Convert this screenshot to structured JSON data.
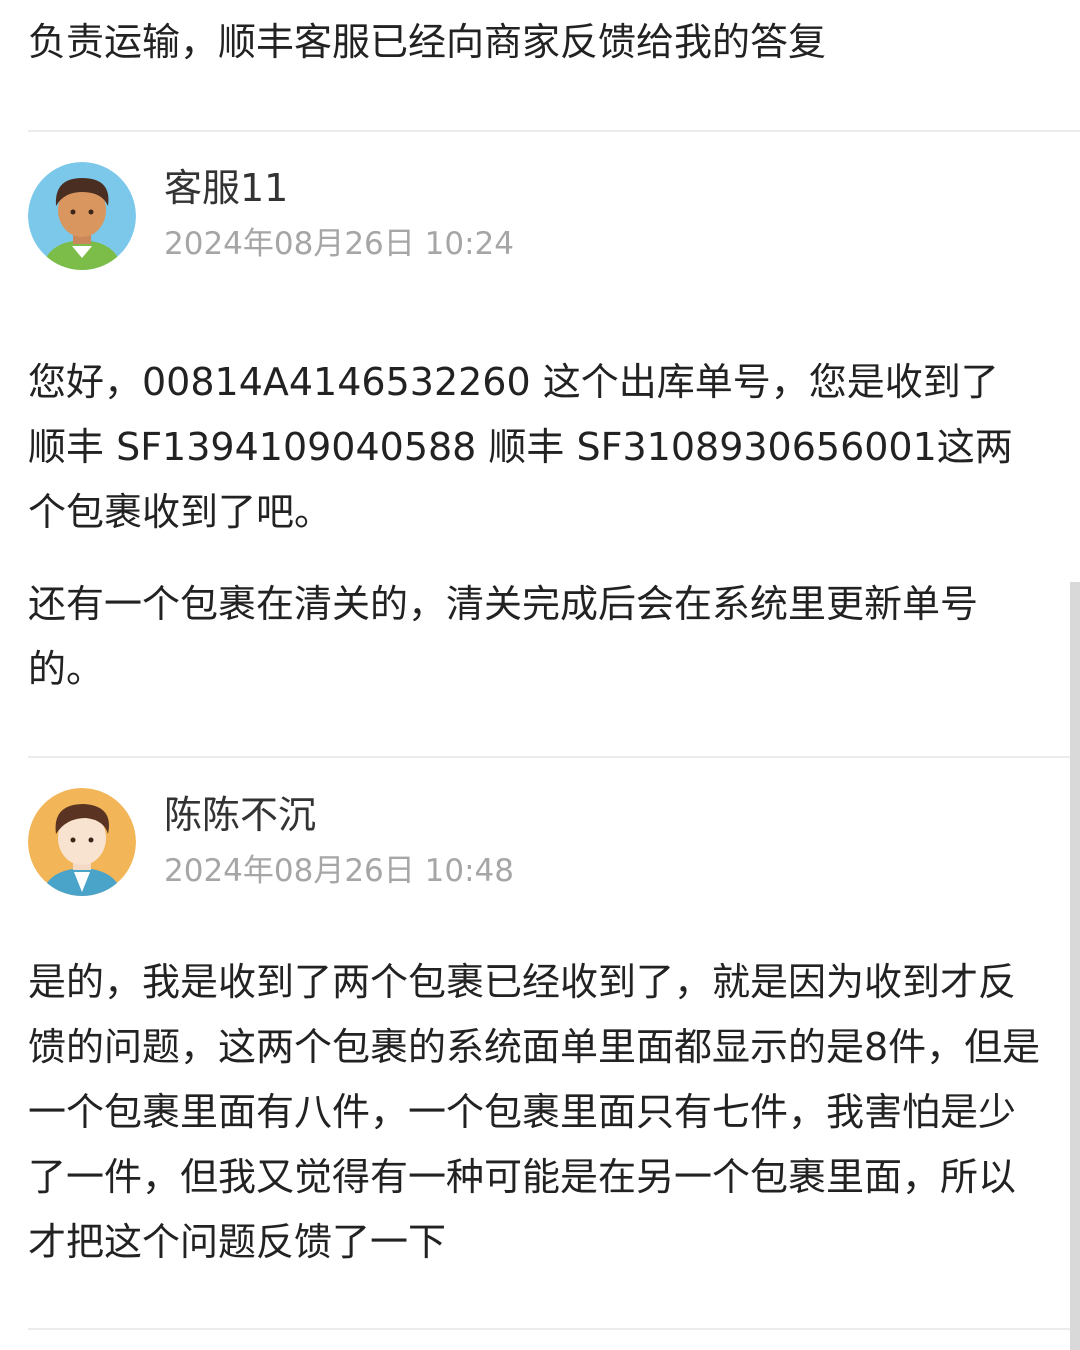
{
  "top_text": "负责运输，顺丰客服已经向商家反馈给我的答复",
  "comments": [
    {
      "name": "客服11",
      "time": "2024年08月26日 10:24",
      "avatar_icon": "boy-avatar-icon",
      "avatar_bg": "#7cc8ea",
      "paragraphs": [
        "您好，00814A4146532260 这个出库单号，您是收到了 顺丰 SF1394109040588 顺丰 SF3108930656001这两个包裹收到了吧。",
        "还有一个包裹在清关的，清关完成后会在系统里更新单号的。"
      ]
    },
    {
      "name": "陈陈不沉",
      "time": "2024年08月26日 10:48",
      "avatar_icon": "man-avatar-icon",
      "avatar_bg": "#f2b558",
      "paragraphs": [
        "是的，我是收到了两个包裹已经收到了，就是因为收到才反馈的问题，这两个包裹的系统面单里面都显示的是8件，但是一个包裹里面有八件，一个包裹里面只有七件，我害怕是少了一件，但我又觉得有一种可能是在另一个包裹里面，所以才把这个问题反馈了一下"
      ]
    }
  ]
}
